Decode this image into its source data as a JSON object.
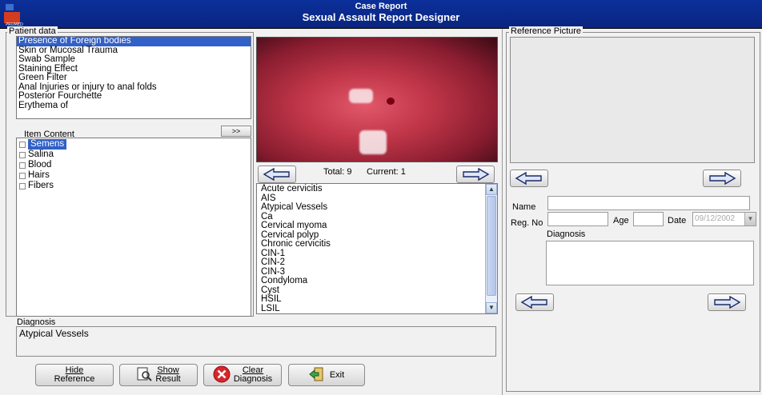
{
  "window": {
    "small_title": "Case Report",
    "main_title": "Sexual Assault Report Designer",
    "logo_text": "PROMED"
  },
  "patient_data": {
    "label": "Patient data",
    "items": [
      "Presence of Foreign bodies",
      "Skin or Mucosal Trauma",
      "Swab Sample",
      "Staining Effect",
      "Green Filter",
      "Anal Injuries or injury to anal folds",
      "Posterior Fourchette",
      "Erythema of"
    ],
    "selected_index": 0
  },
  "item_content": {
    "label": "Item Content",
    "expand_label": ">>",
    "items": [
      "Semens",
      "Salina",
      "Blood",
      "Hairs",
      "Fibers"
    ],
    "selected_index": 0
  },
  "viewer": {
    "total_label": "Total: 9",
    "current_label": "Current: 1",
    "total": 9,
    "current": 1
  },
  "diagnosis_list": {
    "items": [
      "Acute cervicitis",
      "AIS",
      "Atypical Vessels",
      "Ca",
      "Cervical myoma",
      "Cervical polyp",
      "Chronic cervicitis",
      "CIN-1",
      "CIN-2",
      "CIN-3",
      "Condyloma",
      "Cyst",
      "HSIL",
      "LSIL"
    ]
  },
  "diagnosis_box": {
    "label": "Diagnosis",
    "value": "Atypical Vessels"
  },
  "reference": {
    "label": "Reference Picture",
    "name_label": "Name",
    "name_value": "",
    "regno_label": "Reg. No",
    "regno_value": "",
    "age_label": "Age",
    "age_value": "",
    "date_label": "Date",
    "date_value": "09/12/2002",
    "diagnosis_label": "Diagnosis",
    "diagnosis_value": ""
  },
  "buttons": {
    "hide_reference": [
      "Hide",
      "Reference"
    ],
    "show_result": [
      "Show",
      "Result"
    ],
    "clear_diagnosis": [
      "Clear",
      "Diagnosis"
    ],
    "exit": "Exit"
  },
  "colors": {
    "title_bar": "#0b2f9a",
    "selection": "#3160c8",
    "panel": "#f1f1f1"
  }
}
